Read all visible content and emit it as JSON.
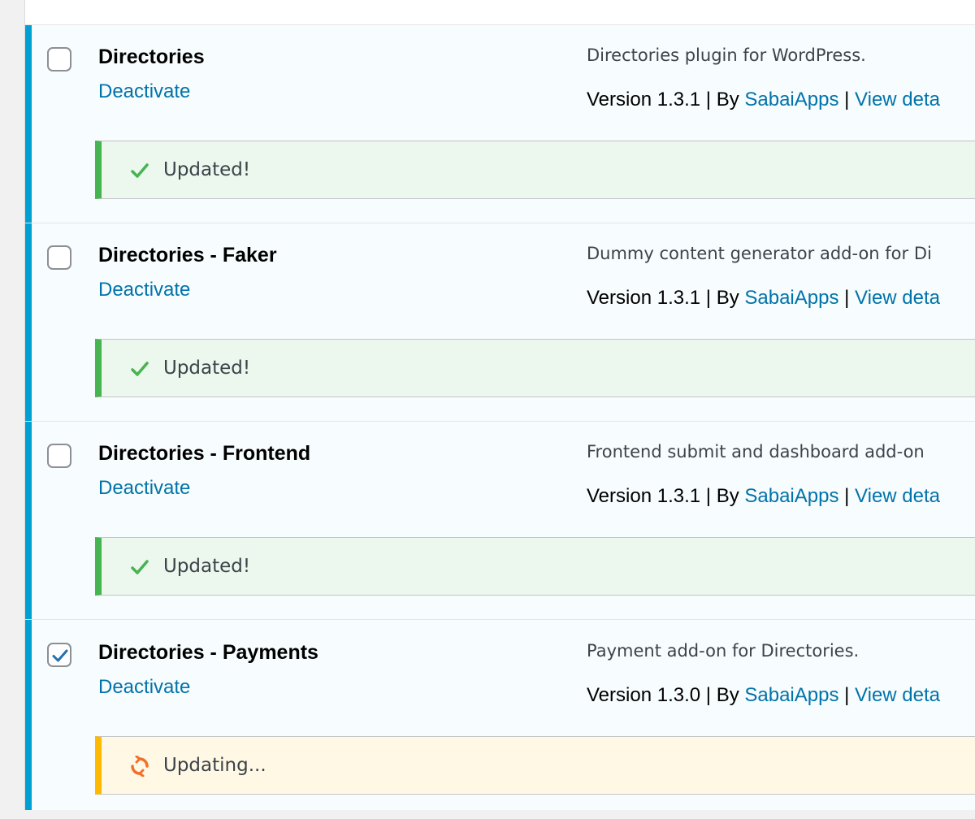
{
  "plugins": [
    {
      "name": "Directories",
      "action": "Deactivate",
      "description": "Directories plugin for WordPress.",
      "version": "Version 1.3.1",
      "by": "By",
      "author": "SabaiApps",
      "details": "View deta",
      "checked": false,
      "status": "Updated!",
      "status_type": "success"
    },
    {
      "name": "Directories - Faker",
      "action": "Deactivate",
      "description": "Dummy content generator add-on for Di",
      "version": "Version 1.3.1",
      "by": "By",
      "author": "SabaiApps",
      "details": "View deta",
      "checked": false,
      "status": "Updated!",
      "status_type": "success"
    },
    {
      "name": "Directories - Frontend",
      "action": "Deactivate",
      "description": "Frontend submit and dashboard add-on",
      "version": "Version 1.3.1",
      "by": "By",
      "author": "SabaiApps",
      "details": "View deta",
      "checked": false,
      "status": "Updated!",
      "status_type": "success"
    },
    {
      "name": "Directories - Payments",
      "action": "Deactivate",
      "description": "Payment add-on for Directories.",
      "version": "Version 1.3.0",
      "by": "By",
      "author": "SabaiApps",
      "details": "View deta",
      "checked": true,
      "status": "Updating...",
      "status_type": "updating"
    }
  ],
  "separator": "|",
  "colors": {
    "link": "#0073aa",
    "active_bar": "#00a0d2",
    "success": "#46b450",
    "warning": "#ffb900",
    "spinner": "#f56e28",
    "checkmark": "#2271b1"
  }
}
